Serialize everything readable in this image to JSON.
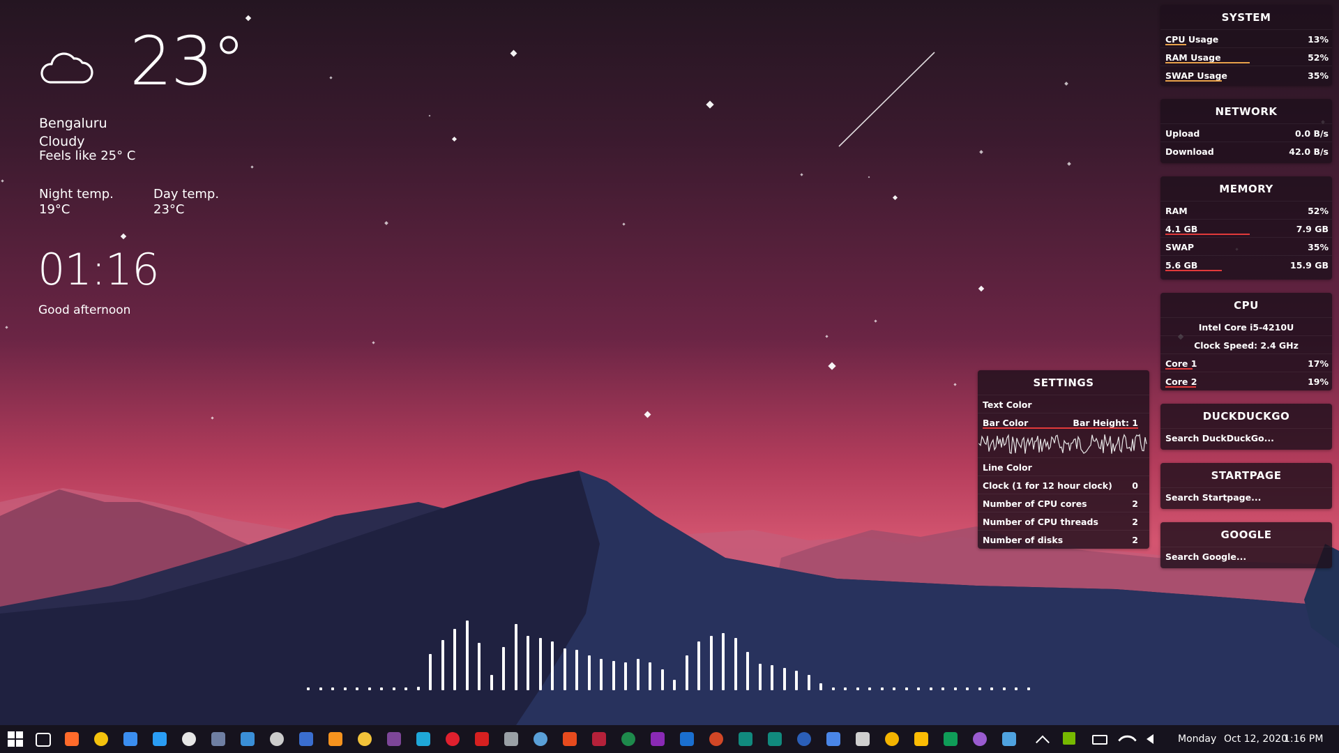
{
  "weather": {
    "temperature": "23°",
    "city": "Bengaluru",
    "condition": "Cloudy",
    "feels_like": "Feels like 25° C",
    "night_label": "Night temp.",
    "night_value": "19°C",
    "day_label": "Day temp.",
    "day_value": "23°C",
    "icon": "cloud-icon"
  },
  "clock": {
    "time": "01:16",
    "greeting": "Good afternoon"
  },
  "system": {
    "title": "SYSTEM",
    "rows": [
      {
        "label": "CPU Usage",
        "value": "13%",
        "fill": 0.13,
        "color": "#e8a24a"
      },
      {
        "label": "RAM Usage",
        "value": "52%",
        "fill": 0.52,
        "color": "#e8a24a"
      },
      {
        "label": "SWAP Usage",
        "value": "35%",
        "fill": 0.35,
        "color": "#e8a24a"
      }
    ]
  },
  "network": {
    "title": "NETWORK",
    "rows": [
      {
        "label": "Upload",
        "value": "0.0 B/s"
      },
      {
        "label": "Download",
        "value": "42.0 B/s"
      }
    ]
  },
  "memory": {
    "title": "MEMORY",
    "rows": [
      {
        "label": "RAM",
        "value": "52%"
      },
      {
        "label": "4.1 GB",
        "value": "7.9 GB",
        "fill": 0.52,
        "color": "#e23a3a"
      },
      {
        "label": "SWAP",
        "value": "35%"
      },
      {
        "label": "5.6 GB",
        "value": "15.9 GB",
        "fill": 0.35,
        "color": "#e23a3a"
      }
    ]
  },
  "cpu": {
    "title": "CPU",
    "model": "Intel Core i5-4210U",
    "clock": "Clock Speed: 2.4 GHz",
    "rows": [
      {
        "label": "Core 1",
        "value": "17%",
        "fill": 0.17,
        "color": "#e23a3a"
      },
      {
        "label": "Core 2",
        "value": "19%",
        "fill": 0.19,
        "color": "#e23a3a"
      }
    ]
  },
  "duckduckgo": {
    "title": "DUCKDUCKGO",
    "placeholder": "Search DuckDuckGo..."
  },
  "startpage": {
    "title": "STARTPAGE",
    "placeholder": "Search Startpage..."
  },
  "google": {
    "title": "GOOGLE",
    "placeholder": "Search Google..."
  },
  "settings": {
    "title": "SETTINGS",
    "text_color": "Text Color",
    "bar_color": "Bar Color",
    "bar_height": "Bar Height: 1",
    "line_color": "Line Color",
    "rows": [
      {
        "label": "Clock (1 for 12 hour clock)",
        "value": "0"
      },
      {
        "label": "Number of CPU cores",
        "value": "2"
      },
      {
        "label": "Number of CPU threads",
        "value": "2"
      },
      {
        "label": "Number of disks",
        "value": "2"
      }
    ]
  },
  "visualizer": {
    "levels": [
      0,
      0,
      0,
      0,
      0,
      0,
      0,
      0,
      0,
      0.05,
      0.52,
      0.72,
      0.88,
      1.0,
      0.68,
      0.22,
      0.62,
      0.95,
      0.78,
      0.75,
      0.7,
      0.6,
      0.58,
      0.5,
      0.45,
      0.42,
      0.4,
      0.45,
      0.4,
      0.3,
      0.15,
      0.5,
      0.7,
      0.78,
      0.82,
      0.75,
      0.55,
      0.38,
      0.36,
      0.32,
      0.28,
      0.22,
      0.1,
      0,
      0,
      0,
      0,
      0,
      0,
      0,
      0,
      0,
      0,
      0,
      0,
      0,
      0,
      0,
      0,
      0
    ]
  },
  "taskbar": {
    "day": "Monday",
    "date": "Oct 12, 2020",
    "time": "1:16 PM",
    "icons": [
      {
        "name": "start-icon",
        "color": "#ffffff"
      },
      {
        "name": "task-view-icon",
        "color": "#ffffff"
      },
      {
        "name": "firefox-icon",
        "color": "#ff6b2b"
      },
      {
        "name": "chrome-icon",
        "color": "#f4c20d"
      },
      {
        "name": "firefox-dev-icon",
        "color": "#3b8ef0"
      },
      {
        "name": "vscode-icon",
        "color": "#2a9df4"
      },
      {
        "name": "notepad-icon",
        "color": "#e6e6e6"
      },
      {
        "name": "calculator-icon",
        "color": "#6f7fa3"
      },
      {
        "name": "remote-desktop-icon",
        "color": "#3a8fd8"
      },
      {
        "name": "terminal-icon",
        "color": "#cccccc"
      },
      {
        "name": "powershell-icon",
        "color": "#3a6ed0"
      },
      {
        "name": "vlc-icon",
        "color": "#f7931e"
      },
      {
        "name": "file-explorer-icon",
        "color": "#f3c33a"
      },
      {
        "name": "tor-browser-icon",
        "color": "#7d4698"
      },
      {
        "name": "edge-icon",
        "color": "#1fa7d8"
      },
      {
        "name": "opera-icon",
        "color": "#e0202e"
      },
      {
        "name": "acrobat-icon",
        "color": "#d62020"
      },
      {
        "name": "wifi-analyzer-icon",
        "color": "#9aa0a6"
      },
      {
        "name": "ccleaner-icon",
        "color": "#5aa0d8"
      },
      {
        "name": "office-icon",
        "color": "#e74b1e"
      },
      {
        "name": "access-icon",
        "color": "#b5213a"
      },
      {
        "name": "excel-icon",
        "color": "#1e8a4c"
      },
      {
        "name": "onenote-icon",
        "color": "#8a2ab5"
      },
      {
        "name": "outlook-icon",
        "color": "#1a6fd0"
      },
      {
        "name": "powerpoint-icon",
        "color": "#d24726"
      },
      {
        "name": "publisher-icon",
        "color": "#118a7e"
      },
      {
        "name": "sway-icon",
        "color": "#118a7e"
      },
      {
        "name": "word-icon",
        "color": "#2b5fb8"
      },
      {
        "name": "docs-icon",
        "color": "#4a86e8"
      },
      {
        "name": "file-icon",
        "color": "#cfcfcf"
      },
      {
        "name": "slides-icon",
        "color": "#f4b400"
      },
      {
        "name": "keep-icon",
        "color": "#fbbc04"
      },
      {
        "name": "sheets-icon",
        "color": "#0f9d58"
      },
      {
        "name": "forms-icon",
        "color": "#9a5bd0"
      },
      {
        "name": "drop-icon",
        "color": "#4fa3e0"
      }
    ]
  }
}
